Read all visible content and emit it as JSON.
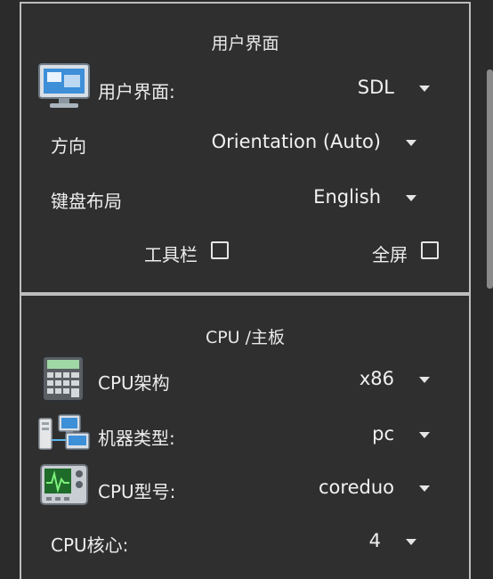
{
  "ui_section": {
    "title": "用户界面",
    "display_label": "用户界面:",
    "display_value": "SDL",
    "orientation_label": "方向",
    "orientation_value": "Orientation (Auto)",
    "keyboard_label": "键盘布局",
    "keyboard_value": "English",
    "toolbar_label": "工具栏",
    "fullscreen_label": "全屏"
  },
  "cpu_section": {
    "title": "CPU /主板",
    "arch_label": "CPU架构",
    "arch_value": "x86",
    "machine_label": "机器类型:",
    "machine_value": "pc",
    "model_label": "CPU型号:",
    "model_value": "coreduo",
    "cores_label": "CPU核心:",
    "cores_value": "4"
  },
  "icons": {
    "display": "monitor-icon",
    "arch": "calculator-icon",
    "machine": "network-computers-icon",
    "model": "cpu-monitor-icon"
  },
  "colors": {
    "background": "#2b2b2b",
    "panel_border": "#bdbdbd",
    "text": "#ececec"
  }
}
